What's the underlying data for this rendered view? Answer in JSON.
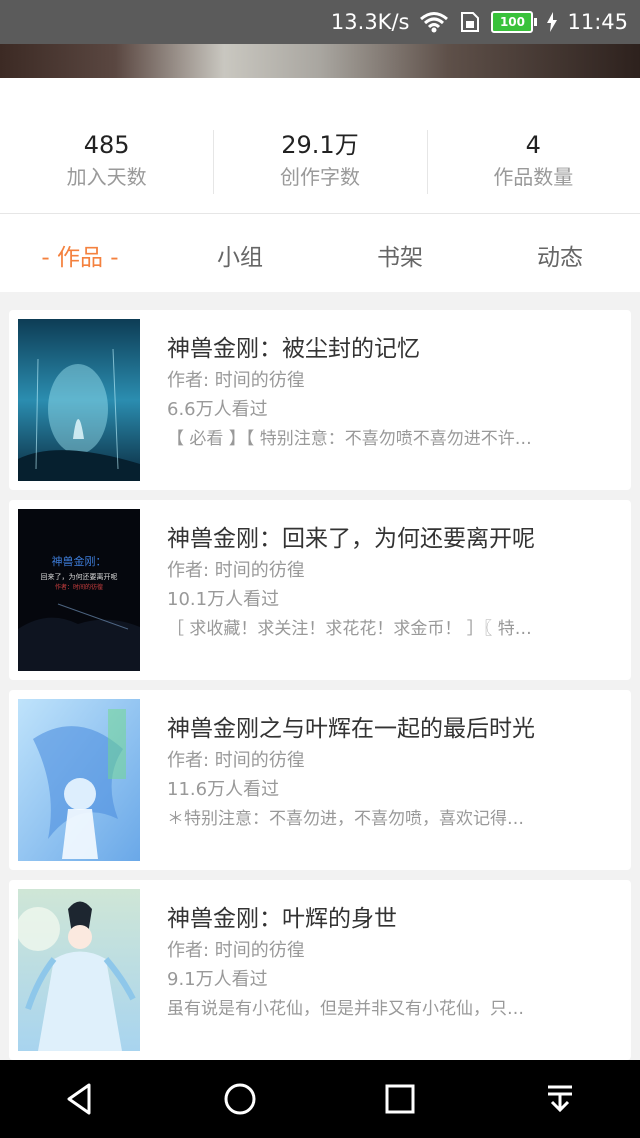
{
  "status_bar": {
    "speed": "13.3K/s",
    "battery": "100",
    "time": "11:45"
  },
  "stats": [
    {
      "value": "485",
      "label": "加入天数"
    },
    {
      "value": "29.1万",
      "label": "创作字数"
    },
    {
      "value": "4",
      "label": "作品数量"
    }
  ],
  "tabs": [
    {
      "label": "- 作品 -"
    },
    {
      "label": "小组"
    },
    {
      "label": "书架"
    },
    {
      "label": "动态"
    }
  ],
  "books": [
    {
      "title": "神兽金刚：被尘封的记忆",
      "author": "作者: 时间的彷徨",
      "views": "6.6万人看过",
      "desc": "【 必看 】【 特别注意：不喜勿喷不喜勿进不许…"
    },
    {
      "title": "神兽金刚：回来了，为何还要离开呢",
      "author": "作者: 时间的彷徨",
      "views": "10.1万人看过",
      "desc": "［ 求收藏！求关注！求花花！求金币！ ］〖 特…",
      "cover_text": [
        "神兽金刚：",
        "回来了，为何还要离开呢",
        "作者：时间的彷徨"
      ]
    },
    {
      "title": "神兽金刚之与叶辉在一起的最后时光",
      "author": "作者: 时间的彷徨",
      "views": "11.6万人看过",
      "desc": "＊特别注意：不喜勿进，不喜勿喷，喜欢记得…"
    },
    {
      "title": "神兽金刚：叶辉的身世",
      "author": "作者: 时间的彷徨",
      "views": "9.1万人看过",
      "desc": "虽有说是有小花仙，但是并非又有小花仙，只…"
    }
  ],
  "colors": {
    "accent": "#f4813e",
    "status_bar": "#5b5b5b",
    "battery": "#39c23b"
  },
  "nav_icons": [
    "back-icon",
    "home-icon",
    "recents-icon",
    "menu-down-icon"
  ]
}
